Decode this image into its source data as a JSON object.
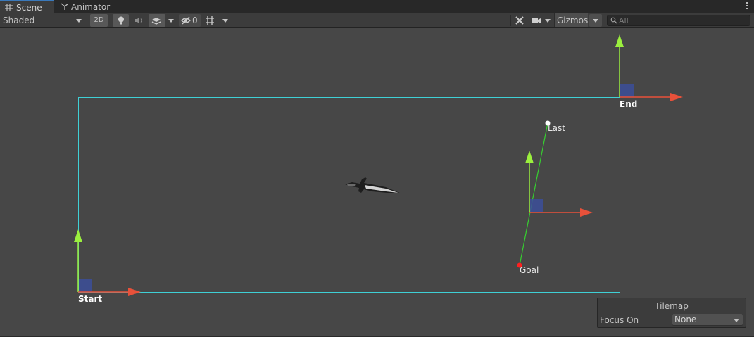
{
  "tabs": {
    "scene": "Scene",
    "animator": "Animator"
  },
  "toolbar": {
    "shading_mode": "Shaded",
    "mode_2d": "2D",
    "hidden_count": "0",
    "gizmos": "Gizmos",
    "search_placeholder": "All"
  },
  "scene": {
    "labels": {
      "start": "Start",
      "end": "End",
      "last": "Last",
      "goal": "Goal"
    }
  },
  "tilemap": {
    "title": "Tilemap",
    "focus_label": "Focus On",
    "focus_value": "None"
  },
  "colors": {
    "bounds_outline": "#3fd0d6",
    "axis_y": "#9bef3e",
    "axis_x": "#e8513a",
    "plane_handle": "#3c4f9a",
    "path_line": "#36d12f",
    "goal_point": "#ff2020",
    "last_point": "#ffffff"
  }
}
